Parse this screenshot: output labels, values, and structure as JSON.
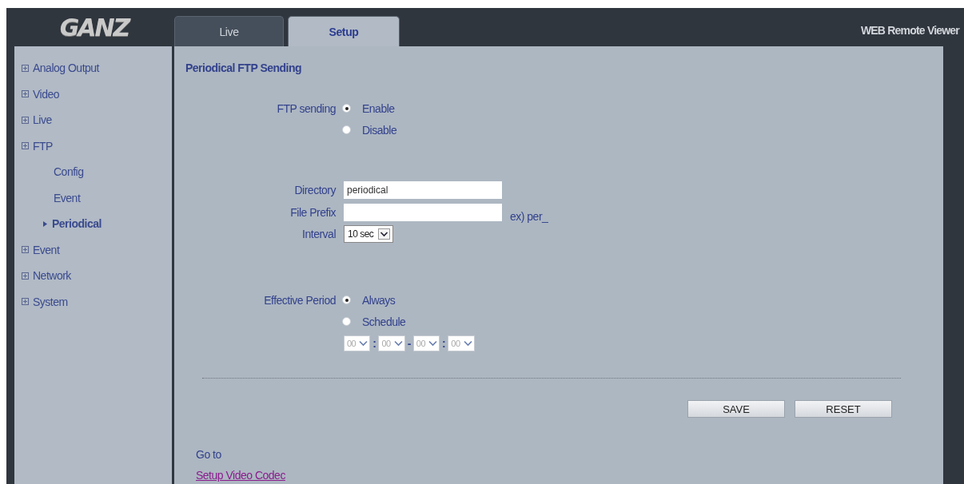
{
  "header": {
    "logo": "GANZ",
    "tabs": [
      {
        "label": "Live",
        "selected": false
      },
      {
        "label": "Setup",
        "selected": true
      }
    ],
    "app_title": "WEB Remote Viewer"
  },
  "sidebar": {
    "items": [
      {
        "label": "Analog Output",
        "selected": false
      },
      {
        "label": "Video",
        "selected": false
      },
      {
        "label": "Live",
        "selected": false
      },
      {
        "label": "FTP",
        "selected": false,
        "children": [
          {
            "label": "Config",
            "selected": false
          },
          {
            "label": "Event",
            "selected": false
          },
          {
            "label": "Periodical",
            "selected": true
          }
        ]
      },
      {
        "label": "Event",
        "selected": false
      },
      {
        "label": "Network",
        "selected": false
      },
      {
        "label": "System",
        "selected": false
      }
    ]
  },
  "form": {
    "title": "Periodical FTP Sending",
    "ftp_sending": {
      "label": "FTP sending",
      "options": [
        {
          "label": "Enable",
          "selected": true
        },
        {
          "label": "Disable",
          "selected": false
        }
      ]
    },
    "directory": {
      "label": "Directory",
      "value": "periodical"
    },
    "file_prefix": {
      "label": "File Prefix",
      "hint": "ex) per_"
    },
    "interval": {
      "label": "Interval",
      "value": "10 sec"
    },
    "effective_period": {
      "label": "Effective Period",
      "options": [
        {
          "label": "Always",
          "selected": true
        },
        {
          "label": "Schedule",
          "selected": false
        }
      ]
    },
    "schedule_time": {
      "disabled": true,
      "parts": [
        {
          "kind": "select",
          "value": "00"
        },
        {
          "kind": "separator",
          "text": ":"
        },
        {
          "kind": "select",
          "value": "00"
        },
        {
          "kind": "separator",
          "text": "-"
        },
        {
          "kind": "select",
          "value": "00"
        },
        {
          "kind": "separator",
          "text": ":"
        },
        {
          "kind": "select",
          "value": "00"
        }
      ]
    },
    "buttons": [
      "SAVE",
      "RESET"
    ],
    "goto": {
      "label": "Go to",
      "link": "Setup Video Codec"
    }
  }
}
